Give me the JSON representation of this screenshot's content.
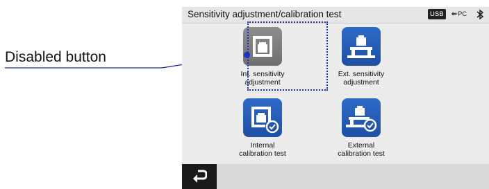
{
  "callout": {
    "label": "Disabled button"
  },
  "status_bar": {
    "title": "Sensitivity adjustment/calibration test",
    "usb_label": "USB",
    "pc_label": "PC",
    "icons": [
      "usb-icon",
      "pc-connection-icon",
      "bluetooth-icon"
    ]
  },
  "tiles": [
    {
      "line1": "Int. sensitivity",
      "line2": "adjustment",
      "state": "disabled",
      "icon": "internal-weight-icon"
    },
    {
      "line1": "Ext. sensitivity",
      "line2": "adjustment",
      "state": "enabled",
      "icon": "external-weight-icon"
    },
    {
      "line1": "Internal",
      "line2": "calibration test",
      "state": "enabled",
      "icon": "internal-calibration-test-icon"
    },
    {
      "line1": "External",
      "line2": "calibration test",
      "state": "enabled",
      "icon": "external-calibration-test-icon"
    }
  ],
  "bottom_bar": {
    "back_icon": "return-arrow-icon"
  },
  "colors": {
    "tile_blue": "#2d6bc9",
    "tile_disabled": "#7f7f7f",
    "highlight": "#1a2fd0",
    "back_bg": "#1a1a1a"
  }
}
